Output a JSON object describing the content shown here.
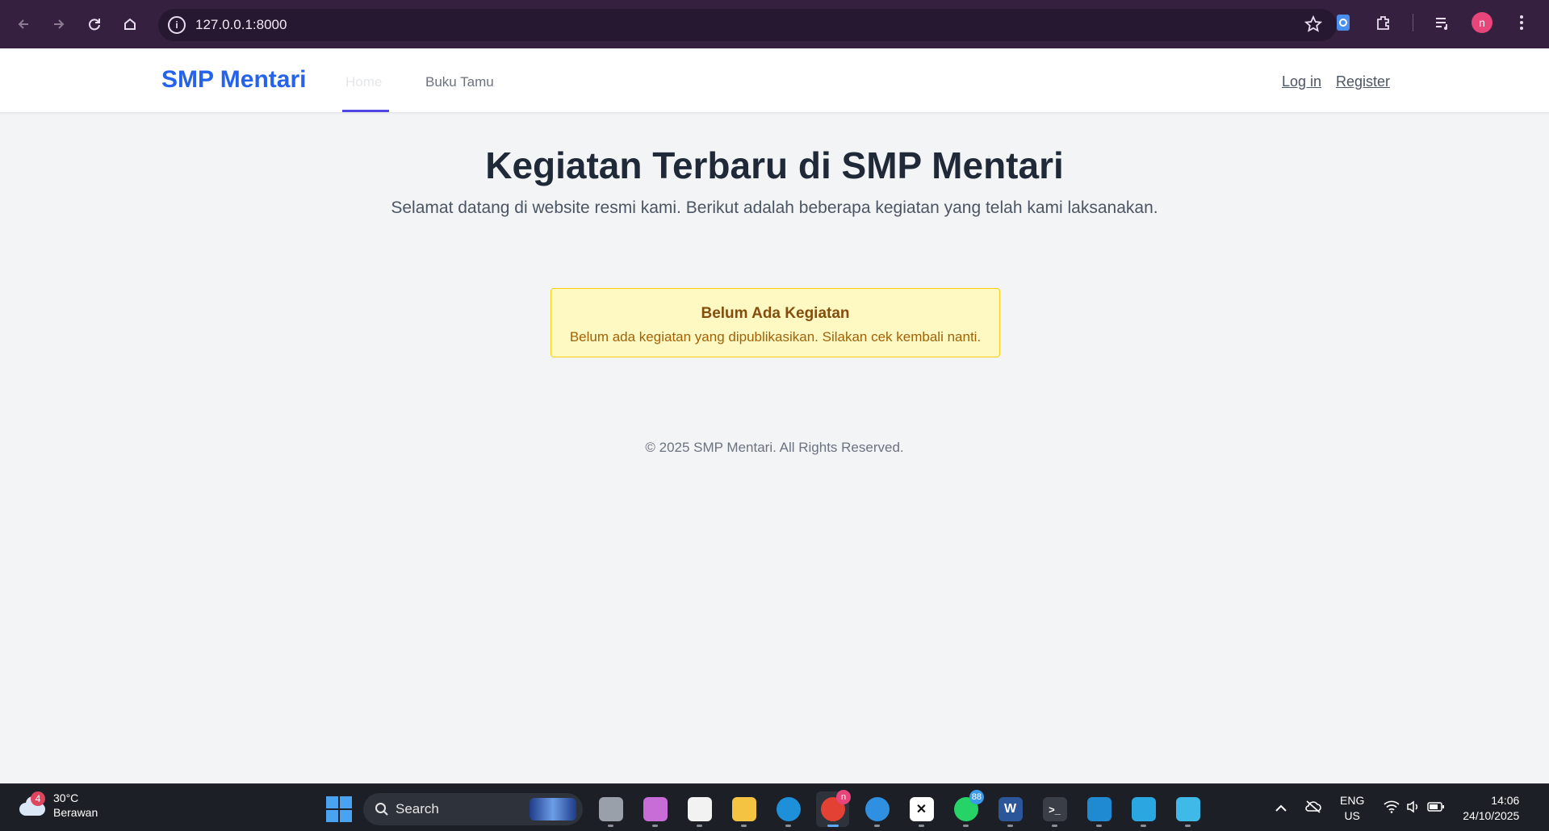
{
  "browser": {
    "url": "127.0.0.1:8000",
    "profile_initial": "n"
  },
  "site": {
    "brand": "SMP Mentari",
    "nav": [
      {
        "label": "Home",
        "active": true
      },
      {
        "label": "Buku Tamu",
        "active": false
      }
    ],
    "auth": {
      "login": "Log in",
      "register": "Register"
    }
  },
  "main": {
    "title": "Kegiatan Terbaru di SMP Mentari",
    "subtitle": "Selamat datang di website resmi kami. Berikut adalah beberapa kegiatan yang telah kami laksanakan.",
    "alert": {
      "title": "Belum Ada Kegiatan",
      "text": "Belum ada kegiatan yang dipublikasikan. Silakan cek kembali nanti."
    }
  },
  "footer": {
    "text": "© 2025 SMP Mentari. All Rights Reserved."
  },
  "taskbar": {
    "weather": {
      "temp": "30°C",
      "condition": "Berawan",
      "badge": "4"
    },
    "search_label": "Search",
    "apps": [
      {
        "name": "task-view-icon",
        "color": "#9aa0aa"
      },
      {
        "name": "copilot-icon",
        "color": "#c86dd7"
      },
      {
        "name": "microsoft-store-icon",
        "color": "#f2f2f2"
      },
      {
        "name": "file-explorer-icon",
        "color": "#f5c342"
      },
      {
        "name": "edge-icon",
        "color": "#1e8fd9"
      },
      {
        "name": "chrome-icon",
        "color": "#e34133",
        "badge": "n",
        "active": true
      },
      {
        "name": "help-icon",
        "color": "#2f8fe0"
      },
      {
        "name": "capcut-icon",
        "color": "#ffffff"
      },
      {
        "name": "whatsapp-icon",
        "color": "#25d366",
        "badge": "88"
      },
      {
        "name": "word-icon",
        "color": "#2b579a",
        "letter": "W"
      },
      {
        "name": "terminal-icon",
        "color": "#3a3f47"
      },
      {
        "name": "vscode-icon",
        "color": "#1f8ad2"
      },
      {
        "name": "app-icon-blue",
        "color": "#2aa6e0"
      },
      {
        "name": "notepad-icon",
        "color": "#3fb9e8"
      }
    ],
    "language": {
      "line1": "ENG",
      "line2": "US"
    },
    "clock": {
      "time": "14:06",
      "date": "24/10/2025"
    }
  }
}
